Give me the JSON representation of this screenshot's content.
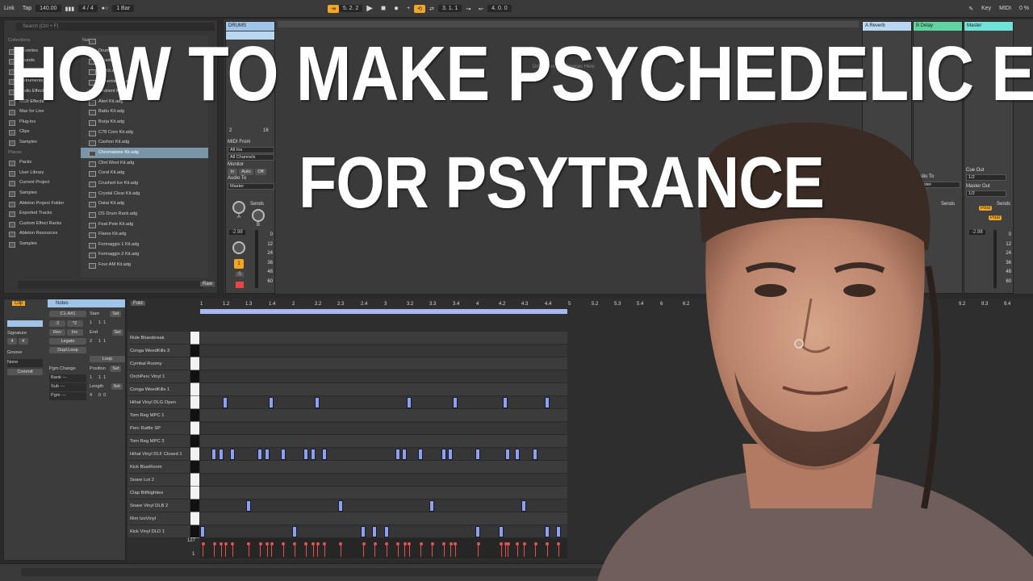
{
  "toolbar": {
    "link": "Link",
    "tap": "Tap",
    "tempo": "140.00",
    "signature": "4 / 4",
    "quantize": "1 Bar",
    "arrangement_position": "5. 2. 2",
    "loop_start": "3. 1. 1",
    "loop_length": "4. 0. 0",
    "key": "Key",
    "midi": "MIDI",
    "cpu": "0 %"
  },
  "browser": {
    "search_placeholder": "Search (Ctrl + F)",
    "collections_header": "Collections",
    "categories": [
      "Favorites",
      "Sounds",
      "Drums",
      "Instruments",
      "Audio Effects",
      "MIDI Effects",
      "Max for Live",
      "Plug-ins",
      "Clips",
      "Samples"
    ],
    "places_header": "Places",
    "places": [
      "Packs",
      "User Library",
      "Current Project",
      "Samples",
      "Ableton Project Folder",
      "Exported Tracks",
      "Custom Effect Racks",
      "Ableton Resources",
      "Samples"
    ],
    "name_header": "Name",
    "items": [
      "Drums",
      "Arcade Ra",
      "Air Kit.adg",
      "Alchemist Kit.adg",
      "Ambient Kit.adg",
      "Alert Kit.adg",
      "Battu Kit.adg",
      "Borja Kit.adg",
      "C78 Core Kit.adg",
      "Cashon Kit.adg",
      "Chromatone Kit.adg",
      "Clint West Kit.adg",
      "Coral Kit.adg",
      "Crushed Ice Kit.adg",
      "Crystal Clear Kit.adg",
      "Datai Kit.adg",
      "DS Drum Rack.adg",
      "Feat Pete Kit.adg",
      "Flares Kit.adg",
      "Formaggio 1 Kit.adg",
      "Formaggio 2 Kit.adg",
      "Four AM Kit.adg"
    ],
    "selected_item": "Chromatone Kit.adg",
    "preview_raw": "Raw"
  },
  "session": {
    "drums_track": "DRUMS",
    "drop_hint": "Drop Files and Devices Here",
    "pad_count": "2",
    "pad_max": "16",
    "midi_from_label": "MIDI From",
    "midi_from": "All Ins",
    "midi_channel": "All Channels",
    "monitor_label": "Monitor",
    "monitor_in": "In",
    "monitor_auto": "Auto",
    "monitor_off": "Off",
    "audio_to_label": "Audio To",
    "audio_to": "Master",
    "sends_label": "Sends",
    "send_a": "A",
    "send_b": "B",
    "volume": "-2.98",
    "scale": [
      "0",
      "12",
      "24",
      "36",
      "48",
      "60"
    ],
    "track_number": "1",
    "solo": "S",
    "return_a": "A Reverb",
    "return_b": "B Delay",
    "master": "Master",
    "return_audio_to": "Master",
    "cue_out_label": "Cue Out",
    "cue_out": "1/2",
    "master_out_label": "Master Out",
    "master_out": "1/2",
    "post": "Post",
    "master_volume": "-2.98"
  },
  "clip": {
    "clip_tab": "Clip",
    "notes_tab": "Notes",
    "signature_label": "Signature",
    "sig_num": "4",
    "sig_den": "4",
    "groove_label": "Groove",
    "groove": "None",
    "commit": "Commit",
    "note_range": "C1-A#1",
    "div2": ":2",
    "mul2": "*2",
    "rev": "Rev",
    "inv": "Inv",
    "legato": "Legato",
    "dupl_loop": "Dupl.Loop",
    "start_label": "Start",
    "set": "Set",
    "start": [
      "1",
      "1",
      "1"
    ],
    "end_label": "End",
    "end": [
      "2",
      "1",
      "1"
    ],
    "loop": "Loop",
    "position_label": "Position",
    "position": [
      "1",
      "1",
      "1"
    ],
    "length_label": "Length",
    "length": [
      "4",
      "0",
      "0"
    ],
    "pgm_change": "Pgm Change",
    "bank": "Bank ---",
    "sub": "Sub ---",
    "pgm": "Pgm ---"
  },
  "editor": {
    "fold": "Fold",
    "ruler": [
      "1",
      "1.2",
      "1.3",
      "1.4",
      "2",
      "2.2",
      "2.3",
      "2.4",
      "3",
      "3.2",
      "3.3",
      "3.4",
      "4",
      "4.2",
      "4.3",
      "4.4",
      "5",
      "5.2",
      "5.3",
      "5.4",
      "6",
      "6.2",
      "9.2",
      "9.3",
      "9.4"
    ],
    "velocity_max": "127",
    "velocity_min": "1",
    "lanes": [
      {
        "name": "Ride Bluesbreak",
        "notes": []
      },
      {
        "name": "Conga WeedKills 3",
        "notes": []
      },
      {
        "name": "Cymbal Roomy",
        "notes": []
      },
      {
        "name": "OrchPerc Vinyl 1",
        "notes": []
      },
      {
        "name": "Conga WeedKills 1",
        "notes": []
      },
      {
        "name": "Hihat Vinyl DLG Open",
        "notes": [
          0.5,
          1.5,
          2.5,
          4.5,
          5.5,
          6.6,
          7.5
        ]
      },
      {
        "name": "Tom Reg MPC 1",
        "notes": []
      },
      {
        "name": "Perc Rattle SP",
        "notes": []
      },
      {
        "name": "Tom Reg MPC 3",
        "notes": []
      },
      {
        "name": "Hihat Vinyl DLF Closed 1",
        "notes": [
          0.25,
          0.4,
          0.65,
          1.25,
          1.4,
          1.75,
          2.25,
          2.4,
          2.65,
          4.25,
          4.4,
          4.75,
          5.25,
          5.4,
          6.0,
          6.65,
          6.85,
          7.25
        ]
      },
      {
        "name": "Kick BlueRoom",
        "notes": []
      },
      {
        "name": "Snare Lot 2",
        "notes": []
      },
      {
        "name": "Clap BitNighties",
        "notes": []
      },
      {
        "name": "Snare Vinyl DLB 2",
        "notes": [
          1.0,
          3.0,
          5.0,
          7.0
        ]
      },
      {
        "name": "Rim IzoVinyl",
        "notes": []
      },
      {
        "name": "Kick Vinyl DLD 1",
        "notes": [
          0.0,
          2.0,
          3.5,
          3.75,
          4.0,
          6.0,
          6.5,
          7.5,
          7.75
        ]
      }
    ]
  },
  "overlay": {
    "line1": "HOW TO MAKE PSYCHEDELIC EFFECTS",
    "line2": "FOR PSYTRANCE"
  },
  "colors": {
    "accent": "#f5a623",
    "drums_header": "#9fc4e8",
    "reverb_header": "#b9d7f0",
    "delay_header": "#5fd3a0",
    "master_header": "#6fe3d9",
    "note": "#8fa0ef"
  }
}
